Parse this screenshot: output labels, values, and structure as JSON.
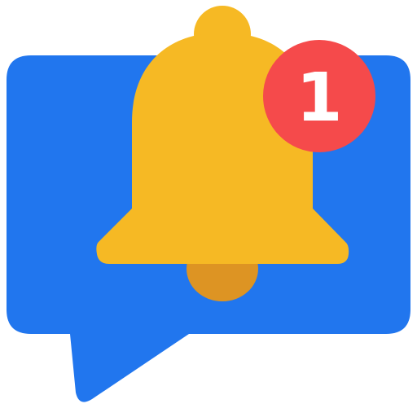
{
  "icon": {
    "name": "notification-bell-message-icon",
    "badge": {
      "count": "1"
    },
    "colors": {
      "bubble": "#2176EE",
      "bell": "#F6B924",
      "clapper": "#DD9423",
      "badge": "#F54A4B",
      "badge_text": "#FFFFFF"
    }
  }
}
